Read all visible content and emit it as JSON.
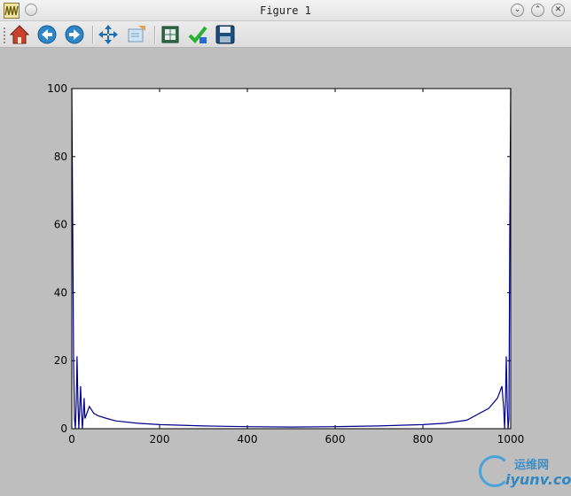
{
  "window": {
    "title": "Figure 1"
  },
  "titlebar_buttons": {
    "minimize": "⌄",
    "maximize": "⌃",
    "close": "✕"
  },
  "toolbar": {
    "icons": [
      "home-icon",
      "back-icon",
      "forward-icon",
      "pan-icon",
      "zoom-icon",
      "subplots-icon",
      "edit-check-icon",
      "save-icon"
    ]
  },
  "watermark": {
    "cn": "运维网",
    "en": "iyunv.com"
  },
  "chart_data": {
    "type": "line",
    "color": "#00008b",
    "xlim": [
      0,
      1000
    ],
    "ylim": [
      0,
      100
    ],
    "xticks": [
      0,
      200,
      400,
      600,
      800,
      1000
    ],
    "yticks": [
      0,
      20,
      40,
      60,
      80,
      100
    ],
    "series": [
      {
        "description_of_shape": "",
        "x": [
          0,
          2,
          4,
          6,
          8,
          10,
          12,
          14,
          16,
          18,
          20,
          22,
          24,
          26,
          28,
          30,
          40,
          50,
          60,
          80,
          100,
          150,
          200,
          300,
          400,
          500,
          600,
          700,
          800,
          850,
          900,
          950,
          970,
          980,
          984,
          986,
          988,
          990,
          992,
          994,
          996,
          998,
          1000
        ],
        "values": [
          100,
          60,
          20,
          3,
          0,
          8,
          21.3,
          8,
          0,
          6,
          12.5,
          5,
          0,
          4,
          9,
          3,
          6.5,
          4.5,
          3.8,
          3,
          2.3,
          1.6,
          1.2,
          0.8,
          0.6,
          0.5,
          0.6,
          0.8,
          1.2,
          1.6,
          2.5,
          6,
          9,
          12.5,
          6,
          0,
          8,
          21.3,
          8,
          0,
          3,
          60,
          100
        ]
      }
    ]
  }
}
